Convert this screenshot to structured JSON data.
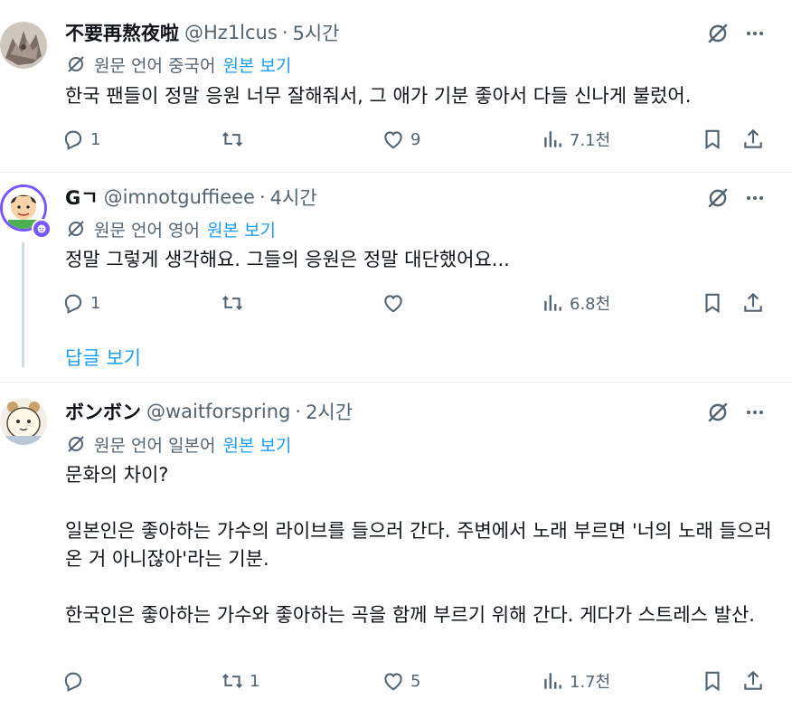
{
  "tweets": [
    {
      "name": "不要再熬夜啦",
      "handle": "@Hz1lcus",
      "dot": "·",
      "time": "5시간",
      "translated_from": "원문 언어 중국어",
      "show_original": "원본 보기",
      "text": "한국 팬들이 정말 응원 너무 잘해줘서, 그 애가 기분 좋아서 다들 신나게 불렀어.",
      "replies": "1",
      "reposts": "",
      "likes": "9",
      "views": "7.1천"
    },
    {
      "name": "Gㄱ",
      "handle": "@imnotguffieee",
      "dot": "·",
      "time": "4시간",
      "translated_from": "원문 언어 영어",
      "show_original": "원본 보기",
      "text": "정말 그렇게 생각해요. 그들의 응원은 정말 대단했어요...",
      "replies": "1",
      "reposts": "",
      "likes": "",
      "views": "6.8천"
    },
    {
      "name": "ボンボン",
      "handle": "@waitforspring",
      "dot": "·",
      "time": "2시간",
      "translated_from": "원문 언어 일본어",
      "show_original": "원본 보기",
      "text": "문화의 차이?\n\n일본인은 좋아하는 가수의 라이브를 들으러 간다. 주변에서 노래 부르면 '너의 노래 들으러 온 거 아니잖아'라는 기분.\n\n한국인은 좋아하는 가수와 좋아하는 곡을 함께 부르기 위해 간다. 게다가 스트레스 발산.",
      "replies": "",
      "reposts": "1",
      "likes": "5",
      "views": "1.7천"
    }
  ],
  "show_replies_label": "답글 보기",
  "icons": {
    "reply": "reply-icon",
    "repost": "repost-icon",
    "like": "like-icon",
    "views": "views-icon",
    "bookmark": "bookmark-icon",
    "share": "share-icon",
    "grok": "grok-icon",
    "more": "more-icon",
    "translate": "translate-icon"
  },
  "colors": {
    "link": "#1d9bf0",
    "muted": "#536471",
    "text": "#0f1419",
    "thread_line": "#cfd9de",
    "verified_ring": "#7856ff"
  }
}
